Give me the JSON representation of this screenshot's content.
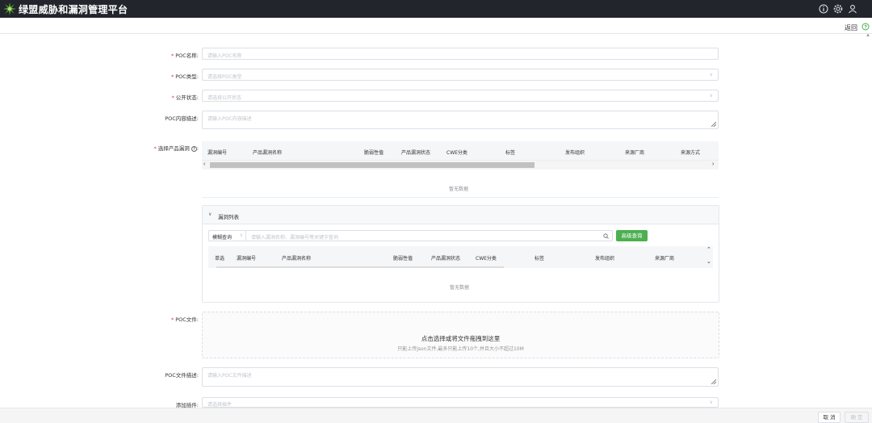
{
  "app": {
    "title": "绿盟威胁和漏洞管理平台"
  },
  "topbar": {
    "icons": [
      "info-icon",
      "gear-icon",
      "user-icon"
    ]
  },
  "subbar": {
    "back_label": "返回"
  },
  "form": {
    "poc_name": {
      "label": "POC名称:",
      "placeholder": "请输入POC名称"
    },
    "poc_type": {
      "label": "POC类型:",
      "placeholder": "请选择POC类型"
    },
    "public_status": {
      "label": "公开状态:",
      "placeholder": "请选择公开状态"
    },
    "poc_desc": {
      "label": "POC内容描述:",
      "placeholder": "请输入POC内容描述"
    },
    "product_vuln": {
      "label": "选择产品漏洞",
      "columns": [
        "漏洞编号",
        "产品漏洞名称",
        "脆弱性值",
        "产品漏洞状态",
        "CWE分类",
        "标签",
        "发布组织",
        "来源厂商",
        "来源方式"
      ],
      "empty_text": "暂无数据"
    },
    "vuln_list": {
      "title": "漏洞列表",
      "search_mode": "模糊查询",
      "search_placeholder": "请输入漏洞名称、漏洞编号等关键字查询",
      "advanced_button": "高级查询",
      "columns": [
        "单选",
        "漏洞编号",
        "产品漏洞名称",
        "脆弱性值",
        "产品漏洞状态",
        "CWE分类",
        "标签",
        "发布组织",
        "来源厂商"
      ],
      "empty_text": "暂无数据"
    },
    "poc_file": {
      "label": "POC文件:",
      "upload_title": "点击选择或将文件拖拽到这里",
      "upload_hint": "只能上传json文件,最多只能上传10个,并且大小不超过10M"
    },
    "poc_file_desc": {
      "label": "POC文件描述:",
      "placeholder": "请输入POC文件描述"
    },
    "plugin": {
      "label": "添加插件:",
      "placeholder": "请选择插件"
    }
  },
  "footer": {
    "cancel_label": "取 消",
    "confirm_label": "确 定"
  },
  "colors": {
    "topbar": "#22252c",
    "accent": "#4caf50",
    "required": "#e03535"
  }
}
